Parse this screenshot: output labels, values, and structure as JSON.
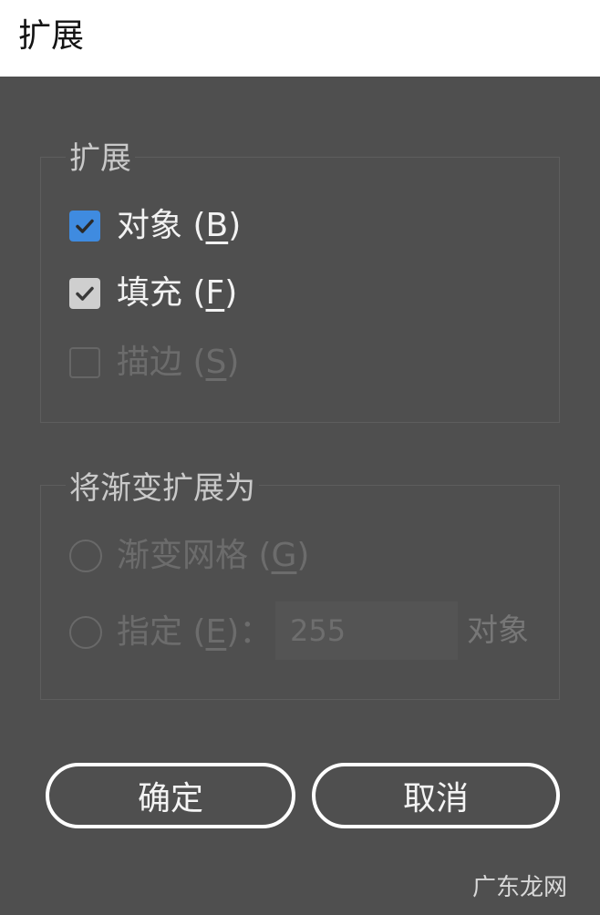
{
  "window": {
    "title": "扩展"
  },
  "expand_group": {
    "title": "扩展",
    "options": [
      {
        "label": "对象",
        "mnemonic": "B",
        "checked": true,
        "enabled": true
      },
      {
        "label": "填充",
        "mnemonic": "F",
        "checked": true,
        "enabled": true
      },
      {
        "label": "描边",
        "mnemonic": "S",
        "checked": false,
        "enabled": false
      }
    ]
  },
  "gradient_group": {
    "title": "将渐变扩展为",
    "options": [
      {
        "label": "渐变网格",
        "mnemonic": "G",
        "selected": false,
        "enabled": false
      },
      {
        "label": "指定",
        "mnemonic": "E",
        "suffix": "：",
        "selected": false,
        "enabled": false
      }
    ],
    "specify_value": "255",
    "specify_unit": "对象"
  },
  "buttons": {
    "ok": "确定",
    "cancel": "取消"
  },
  "watermark": "广东龙网",
  "colors": {
    "dialog_bg": "#4f4f4f",
    "titlebar_bg": "#ffffff",
    "checkbox_accent": "#3f8be0"
  },
  "icons": {
    "checkmark": "check-icon"
  }
}
